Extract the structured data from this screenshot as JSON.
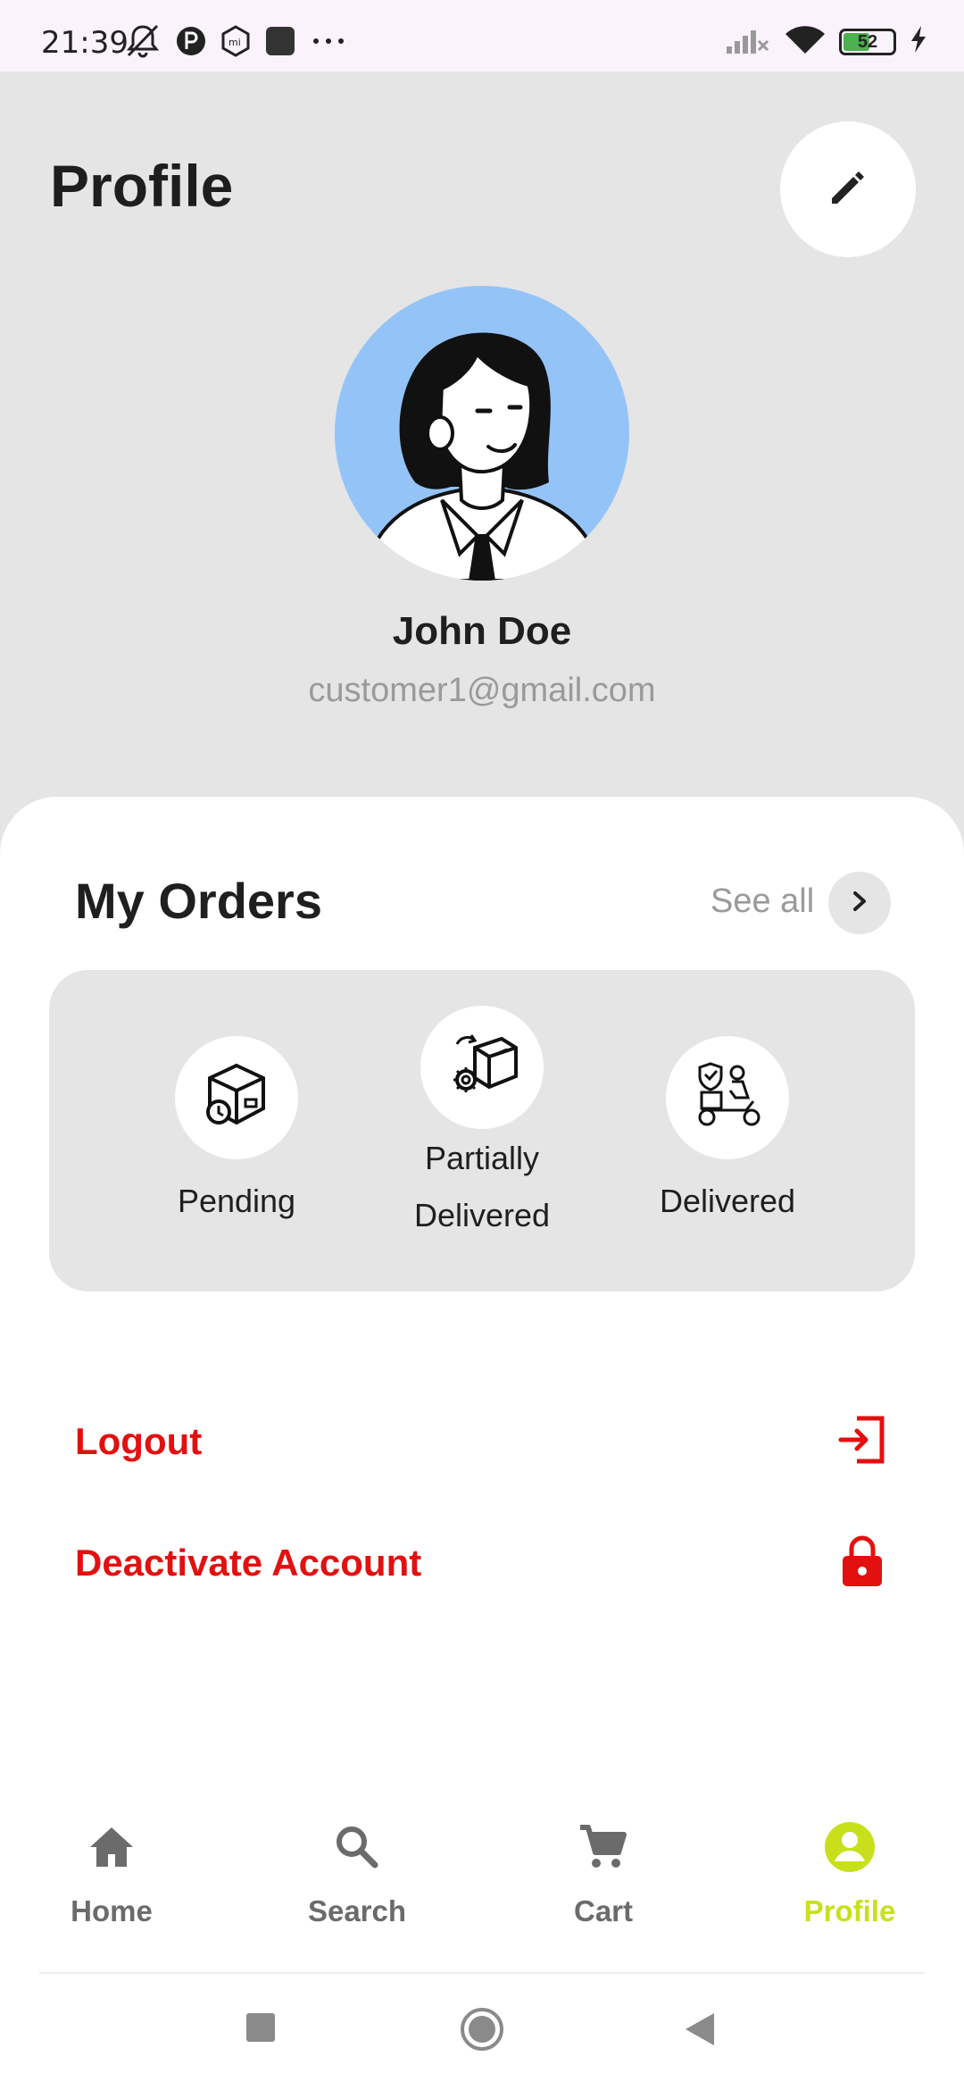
{
  "status_bar": {
    "time": "21:39",
    "battery": "52",
    "icons_left": [
      "mute-icon",
      "app-icon",
      "mi-icon",
      "square-icon",
      "more-icon"
    ],
    "icons_right": [
      "signal-icon",
      "wifi-icon",
      "battery-icon",
      "charging-icon"
    ]
  },
  "header": {
    "title": "Profile",
    "edit_icon": "pencil-icon",
    "user_name": "John Doe",
    "user_email": "customer1@gmail.com",
    "avatar_bg": "#94c4f7"
  },
  "orders": {
    "title": "My Orders",
    "see_all": "See all",
    "items": [
      {
        "label": "Pending",
        "icon": "box-clock-icon"
      },
      {
        "label_line1": "Partially",
        "label_line2": "Delivered",
        "icon": "box-gear-icon"
      },
      {
        "label": "Delivered",
        "icon": "delivery-scooter-icon"
      }
    ]
  },
  "actions": {
    "logout": "Logout",
    "deactivate": "Deactivate Account",
    "accent": "#e31010"
  },
  "bottom_nav": {
    "items": [
      {
        "label": "Home",
        "icon": "home-icon"
      },
      {
        "label": "Search",
        "icon": "search-icon"
      },
      {
        "label": "Cart",
        "icon": "cart-icon"
      },
      {
        "label": "Profile",
        "icon": "profile-icon",
        "active": true
      }
    ],
    "active_color": "#c8e01c",
    "inactive_color": "#6b6b6b"
  }
}
